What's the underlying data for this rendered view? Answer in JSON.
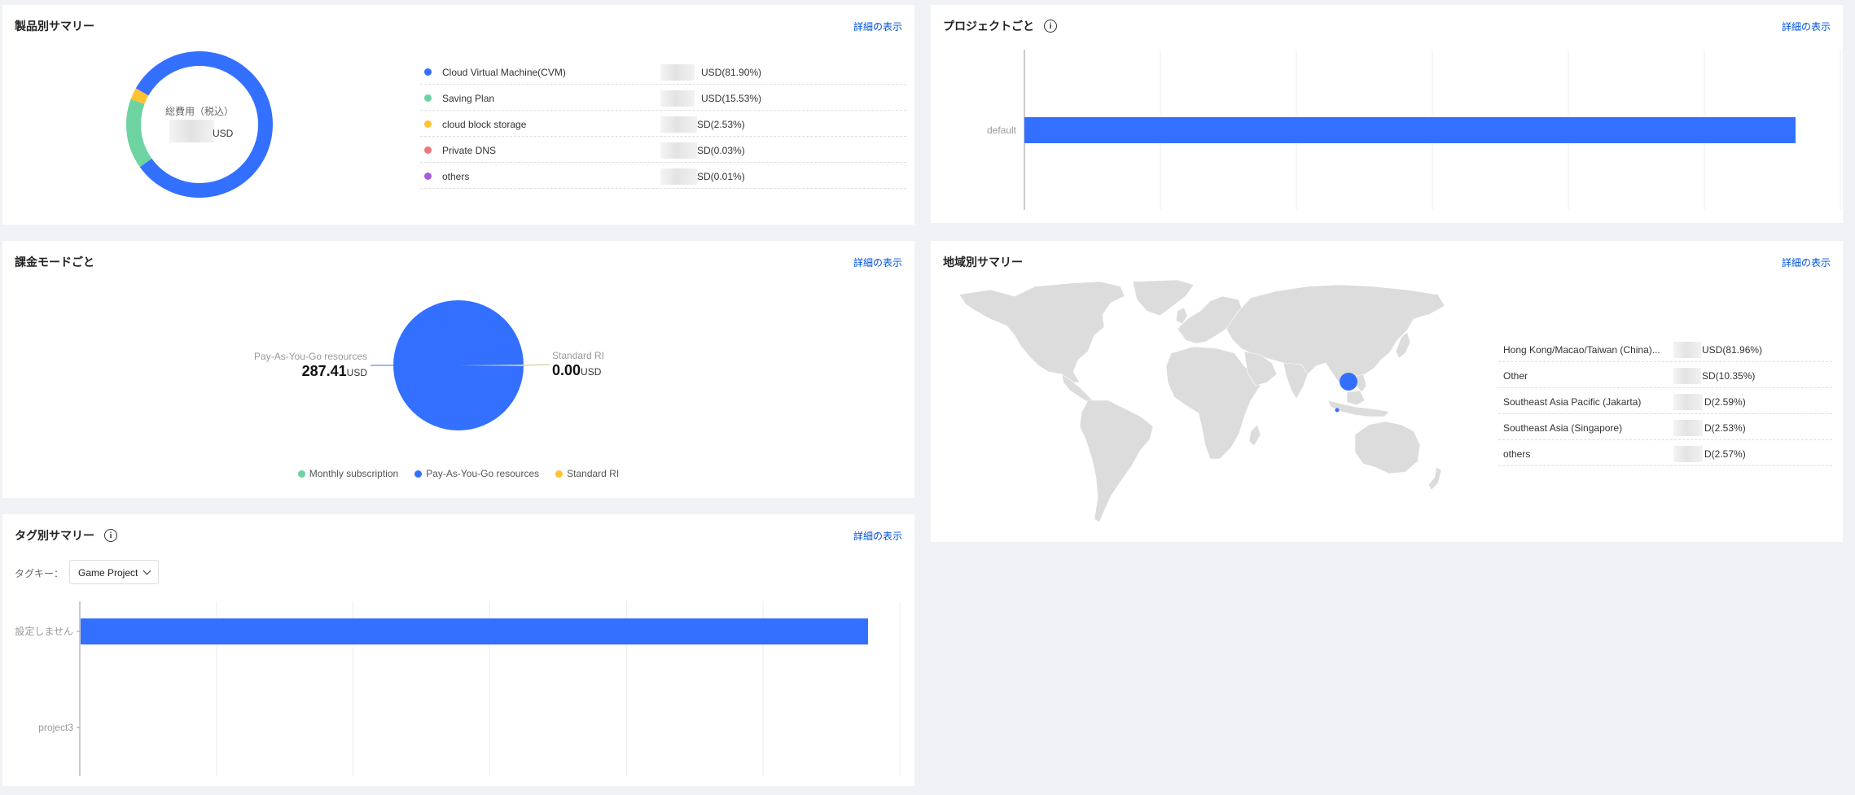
{
  "detail_label": "詳細の表示",
  "product": {
    "title": "製品別サマリー",
    "donut_label": "総費用（税込）",
    "donut_unit": "USD",
    "items": [
      {
        "name": "Cloud Virtual Machine(CVM)",
        "value": "USD(81.90%)",
        "color": "#3370ff"
      },
      {
        "name": "Saving Plan",
        "value": "USD(15.53%)",
        "color": "#6dd3a0"
      },
      {
        "name": "cloud block storage",
        "value": "SD(2.53%)",
        "color": "#ffc233"
      },
      {
        "name": "Private DNS",
        "value": "SD(0.03%)",
        "color": "#f27474"
      },
      {
        "name": "others",
        "value": "SD(0.01%)",
        "color": "#a65ee0"
      }
    ]
  },
  "project": {
    "title": "プロジェクトごと",
    "info_icon": "i"
  },
  "billing": {
    "title": "課金モードごと",
    "left_label": "Pay-As-You-Go resources",
    "left_value": "287.41",
    "left_unit": "USD",
    "right_label": "Standard RI",
    "right_value": "0.00",
    "right_unit": "USD",
    "legend": [
      {
        "name": "Monthly subscription",
        "color": "#6dd3a0"
      },
      {
        "name": "Pay-As-You-Go resources",
        "color": "#3370ff"
      },
      {
        "name": "Standard RI",
        "color": "#ffc233"
      }
    ]
  },
  "region": {
    "title": "地域別サマリー",
    "items": [
      {
        "name": "Hong Kong/Macao/Taiwan (China)...",
        "value": "USD(81.96%)"
      },
      {
        "name": "Other",
        "value": "SD(10.35%)"
      },
      {
        "name": "Southeast Asia Pacific (Jakarta)",
        "value": "D(2.59%)"
      },
      {
        "name": "Southeast Asia (Singapore)",
        "value": "D(2.53%)"
      },
      {
        "name": "others",
        "value": "D(2.57%)"
      }
    ]
  },
  "tag": {
    "title": "タグ別サマリー",
    "info_icon": "i",
    "key_label": "タグキー：",
    "select_value": "Game Project"
  },
  "chart_data": [
    {
      "type": "pie",
      "title": "製品別サマリー",
      "categories": [
        "Cloud Virtual Machine(CVM)",
        "Saving Plan",
        "cloud block storage",
        "Private DNS",
        "others"
      ],
      "values": [
        81.9,
        15.53,
        2.53,
        0.03,
        0.01
      ]
    },
    {
      "type": "bar",
      "title": "プロジェクトごと",
      "orientation": "horizontal",
      "categories": [
        "default"
      ],
      "values": [
        1.0
      ],
      "grid": true
    },
    {
      "type": "pie",
      "title": "課金モードごと",
      "categories": [
        "Monthly subscription",
        "Pay-As-You-Go resources",
        "Standard RI"
      ],
      "values": [
        0,
        287.41,
        0.0
      ]
    },
    {
      "type": "bar",
      "title": "タグ別サマリー",
      "orientation": "horizontal",
      "categories": [
        "設定しません",
        "project3"
      ],
      "values": [
        1.0,
        0
      ],
      "grid": true
    }
  ]
}
